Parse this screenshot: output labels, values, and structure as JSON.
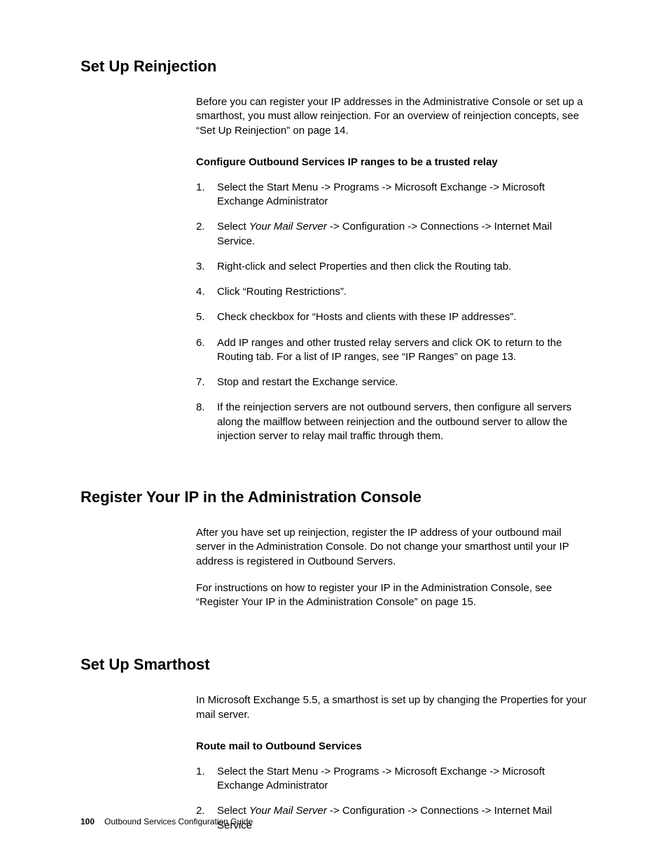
{
  "section1": {
    "heading": "Set Up Reinjection",
    "intro": "Before you can register your IP addresses in the Administrative Console or set up a smarthost, you must allow reinjection. For an overview of reinjection concepts, see “Set Up Reinjection” on page 14.",
    "subheading": "Configure Outbound Services IP ranges to be a trusted relay",
    "steps": {
      "s1": "Select the Start Menu -> Programs -> Microsoft Exchange -> Microsoft Exchange Administrator",
      "s2_prefix": "Select ",
      "s2_italic": "Your Mail Server",
      "s2_suffix": " -> Configuration -> Connections -> Internet Mail Service.",
      "s3": "Right-click and select Properties and then click the Routing tab.",
      "s4": "Click “Routing Restrictions”.",
      "s5": "Check checkbox for “Hosts and clients with these IP addresses”.",
      "s6": "Add IP ranges and other trusted relay servers and click OK to return to the Routing tab. For a list of IP ranges, see “IP Ranges” on page 13.",
      "s7": "Stop and restart the Exchange service.",
      "s8": "If the reinjection servers are not outbound servers, then configure all servers along the mailflow between reinjection and the outbound server to allow the injection server to relay mail traffic through them."
    }
  },
  "section2": {
    "heading": "Register Your IP in the Administration Console",
    "p1": "After you have set up reinjection, register the IP address of your outbound mail server in the Administration Console. Do not change your smarthost until your IP address is registered in Outbound Servers.",
    "p2": "For instructions on how to register your IP in the Administration Console, see “Register Your IP in the Administration Console” on page 15."
  },
  "section3": {
    "heading": "Set Up Smarthost",
    "intro": "In Microsoft Exchange 5.5, a smarthost is set up by changing the Properties for your mail server.",
    "subheading": "Route mail to Outbound Services",
    "steps": {
      "s1": "Select the Start Menu -> Programs -> Microsoft Exchange -> Microsoft Exchange Administrator",
      "s2_prefix": "Select ",
      "s2_italic": "Your Mail Server",
      "s2_suffix": " -> Configuration -> Connections -> Internet Mail Service"
    }
  },
  "footer": {
    "page_number": "100",
    "title": "Outbound Services Configuration Guide"
  }
}
